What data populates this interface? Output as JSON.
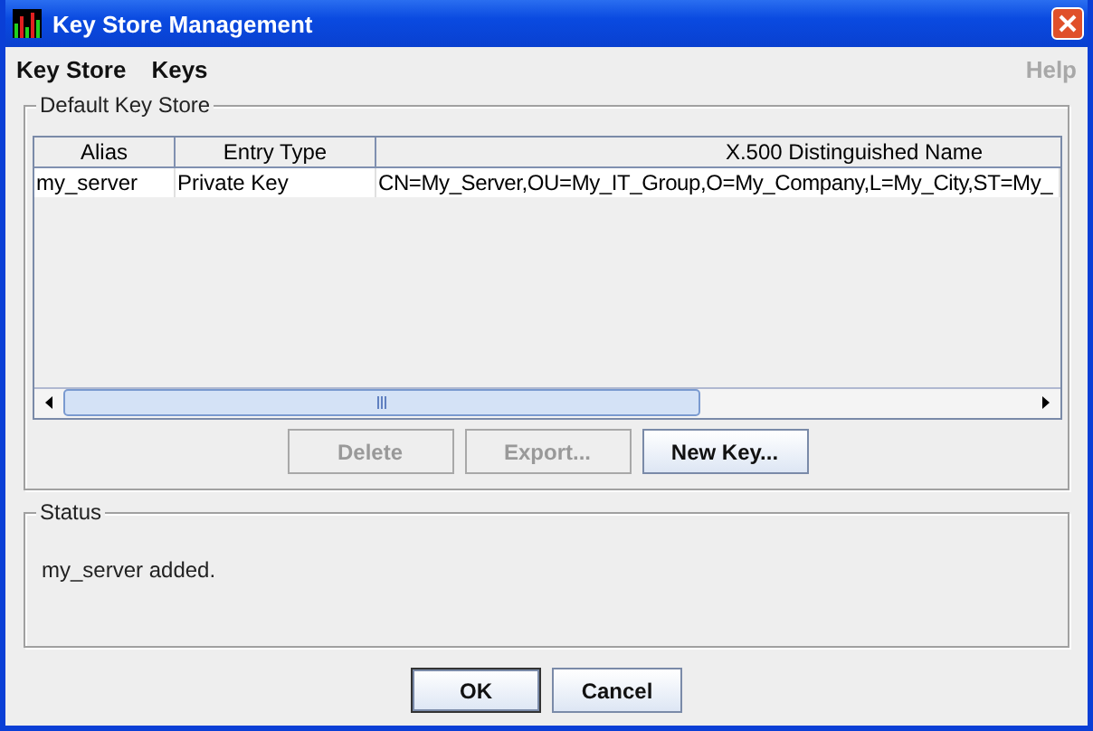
{
  "window": {
    "title": "Key Store Management"
  },
  "menu": [
    {
      "label": "Key Store",
      "disabled": false
    },
    {
      "label": "Keys",
      "disabled": false
    },
    {
      "label": "Help",
      "disabled": true
    }
  ],
  "key_store_panel": {
    "title": "Default Key Store",
    "table": {
      "columns": [
        "Alias",
        "Entry Type",
        "X.500 Distinguished Name"
      ],
      "rows": [
        [
          "my_server",
          "Private Key",
          "CN=My_Server,OU=My_IT_Group,O=My_Company,L=My_City,ST=My_"
        ]
      ]
    },
    "buttons": [
      {
        "label": "Delete",
        "disabled": true
      },
      {
        "label": "Export...",
        "disabled": true
      },
      {
        "label": "New Key...",
        "disabled": false
      }
    ]
  },
  "status_panel": {
    "title": "Status",
    "message": "my_server added."
  },
  "buttons": [
    {
      "label": "OK",
      "default": true
    },
    {
      "label": "Cancel",
      "default": false
    }
  ]
}
